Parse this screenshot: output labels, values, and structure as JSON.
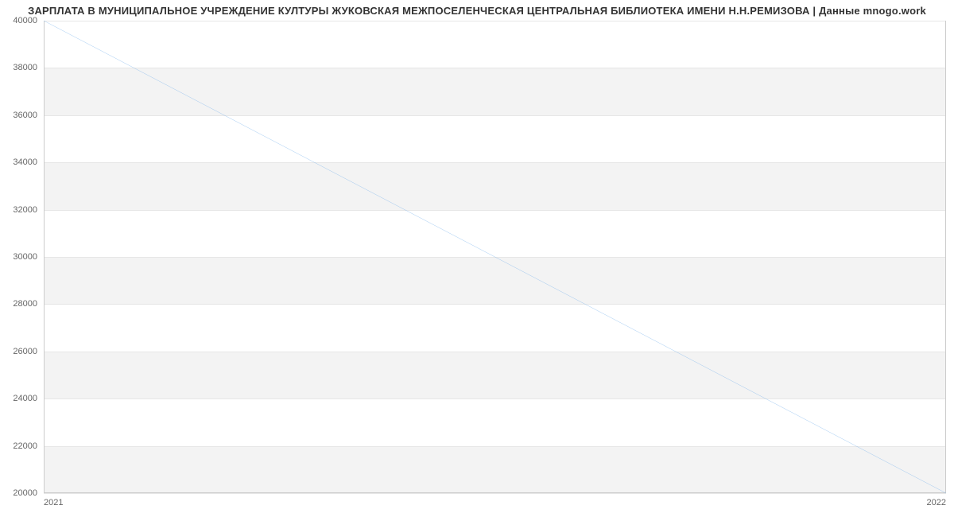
{
  "chart_data": {
    "type": "line",
    "title": "ЗАРПЛАТА В МУНИЦИПАЛЬНОЕ УЧРЕЖДЕНИЕ КУЛТУРЫ ЖУКОВСКАЯ МЕЖПОСЕЛЕНЧЕСКАЯ ЦЕНТРАЛЬНАЯ БИБЛИОТЕКА ИМЕНИ Н.Н.РЕМИЗОВА | Данные mnogo.work",
    "x": [
      2021,
      2022
    ],
    "values": [
      40000,
      20000
    ],
    "x_ticks": [
      2021,
      2022
    ],
    "y_ticks": [
      20000,
      22000,
      24000,
      26000,
      28000,
      30000,
      32000,
      34000,
      36000,
      38000,
      40000
    ],
    "xlim": [
      2021,
      2022
    ],
    "ylim": [
      20000,
      40000
    ],
    "xlabel": "",
    "ylabel": "",
    "line_color": "#7cb5ec"
  }
}
